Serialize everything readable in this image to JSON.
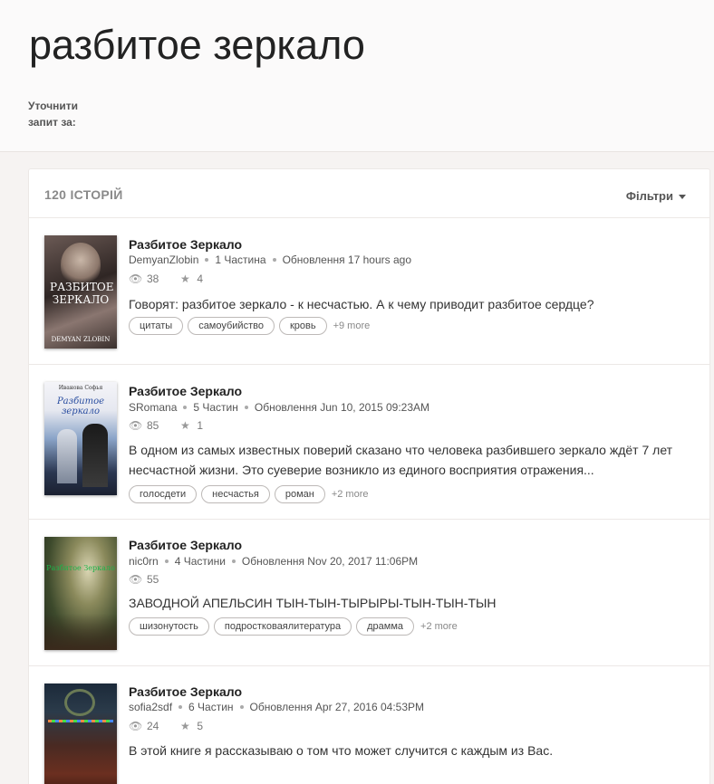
{
  "header": {
    "title": "разбитое зеркало",
    "refine_label": "Уточнити запит за:"
  },
  "panel": {
    "count_label": "120 ІСТОРІЙ",
    "filters_label": "Фільтри"
  },
  "stories": [
    {
      "title": "Разбитое Зеркало",
      "author": "DemyanZlobin",
      "parts": "1 Частина",
      "updated": "Обновлення 17 hours ago",
      "views": "38",
      "votes": "4",
      "description": "Говорят: разбитое зеркало - к несчастью. А к чему приводит разбитое сердце?",
      "tags": [
        "цитаты",
        "самоубийство",
        "кровь"
      ],
      "more": "+9 more",
      "cover_text": "РАЗБИТОЕ ЗЕРКАЛО",
      "cover_author": "DEMYAN ZLOBIN"
    },
    {
      "title": "Разбитое Зеркало",
      "author": "SRomana",
      "parts": "5 Частин",
      "updated": "Обновлення Jun 10, 2015 09:23AM",
      "views": "85",
      "votes": "1",
      "description": "В одном из самых известных поверий сказано что человека разбившего зеркало ждёт 7 лет несчастной жизни. Это суеверие возникло из единого восприятия отражения...",
      "tags": [
        "голосдети",
        "несчастья",
        "роман"
      ],
      "more": "+2 more",
      "cover_text": "Разбитое зеркало",
      "cover_author": "Иванова Софья"
    },
    {
      "title": "Разбитое Зеркало",
      "author": "nic0rn",
      "parts": "4 Частини",
      "updated": "Обновлення Nov 20, 2017 11:06PM",
      "views": "55",
      "description": "ЗАВОДНОЙ АПЕЛЬСИН ТЫН-ТЫН-ТЫРЫРЫ-ТЫН-ТЫН-ТЫН",
      "tags": [
        "шизонутость",
        "подростковаялитература",
        "драмма"
      ],
      "more": "+2 more",
      "cover_text": "Разбитое Зеркало"
    },
    {
      "title": "Разбитое Зеркало",
      "author": "sofia2sdf",
      "parts": "6 Частин",
      "updated": "Обновлення Apr 27, 2016 04:53PM",
      "views": "24",
      "votes": "5",
      "description": "В этой книге я рассказываю о том что может случится с каждым из Вас."
    }
  ],
  "colors": {
    "background": "#f6f3f2",
    "card": "#ffffff",
    "text": "#222222",
    "muted": "#888888"
  },
  "icons": {
    "views": "eye-icon",
    "votes": "star-icon",
    "filters": "caret-down-icon"
  }
}
